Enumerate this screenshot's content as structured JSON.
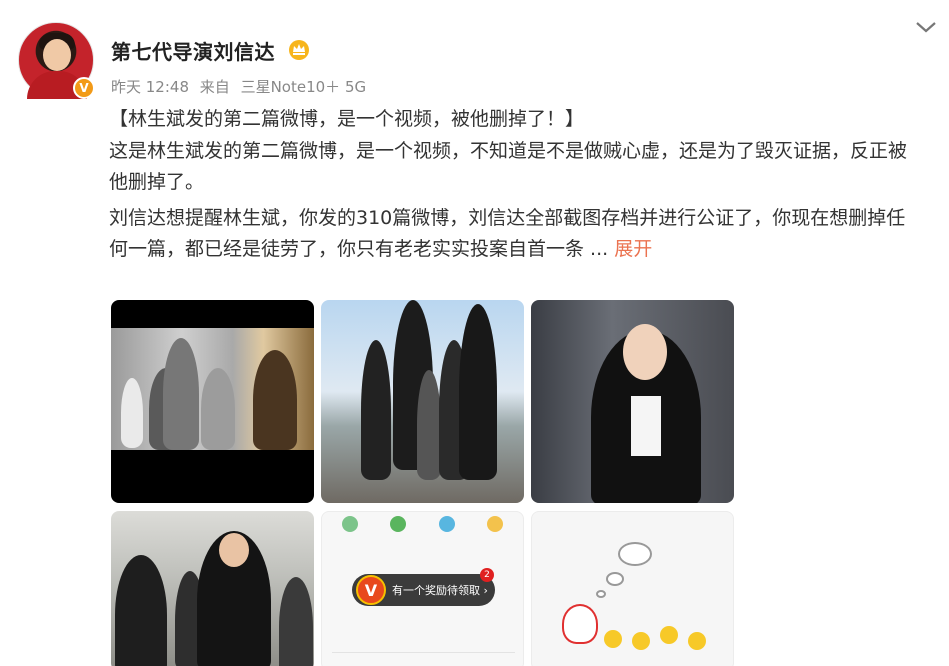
{
  "user": {
    "name": "第七代导演刘信达",
    "verified_badge": "V"
  },
  "meta": {
    "time": "昨天 12:48",
    "source_prefix": "来自",
    "device": "三星Note10＋ 5G"
  },
  "post": {
    "headline": "【林生斌发的第二篇微博，是一个视频，被他删掉了！】",
    "paragraph1": "这是林生斌发的第二篇微博，是一个视频，不知道是不是做贼心虚，还是为了毁灭证据，反正被他删掉了。",
    "paragraph2": "刘信达想提醒林生斌，你发的310篇微博，刘信达全部截图存档并进行公证了，你现在想删掉任何一篇，都已经是徒劳了，你只有老老实实投案自首一条 ...",
    "expand_label": "展开"
  },
  "thumbnails": [
    {
      "label": "photo-1"
    },
    {
      "label": "photo-2"
    },
    {
      "label": "photo-3"
    },
    {
      "label": "photo-4"
    },
    {
      "label": "photo-5",
      "vip_text": "有一个奖励待领取 ›",
      "vip_badge": "2",
      "vip_letter": "V"
    },
    {
      "label": "photo-6"
    }
  ],
  "icons": {
    "chevron": "chevron-down-icon",
    "crown": "crown-icon",
    "verified": "verified-icon"
  },
  "colors": {
    "expand_link": "#eb7350",
    "verified_badge": "#f29a18",
    "meta_text": "#888888"
  }
}
